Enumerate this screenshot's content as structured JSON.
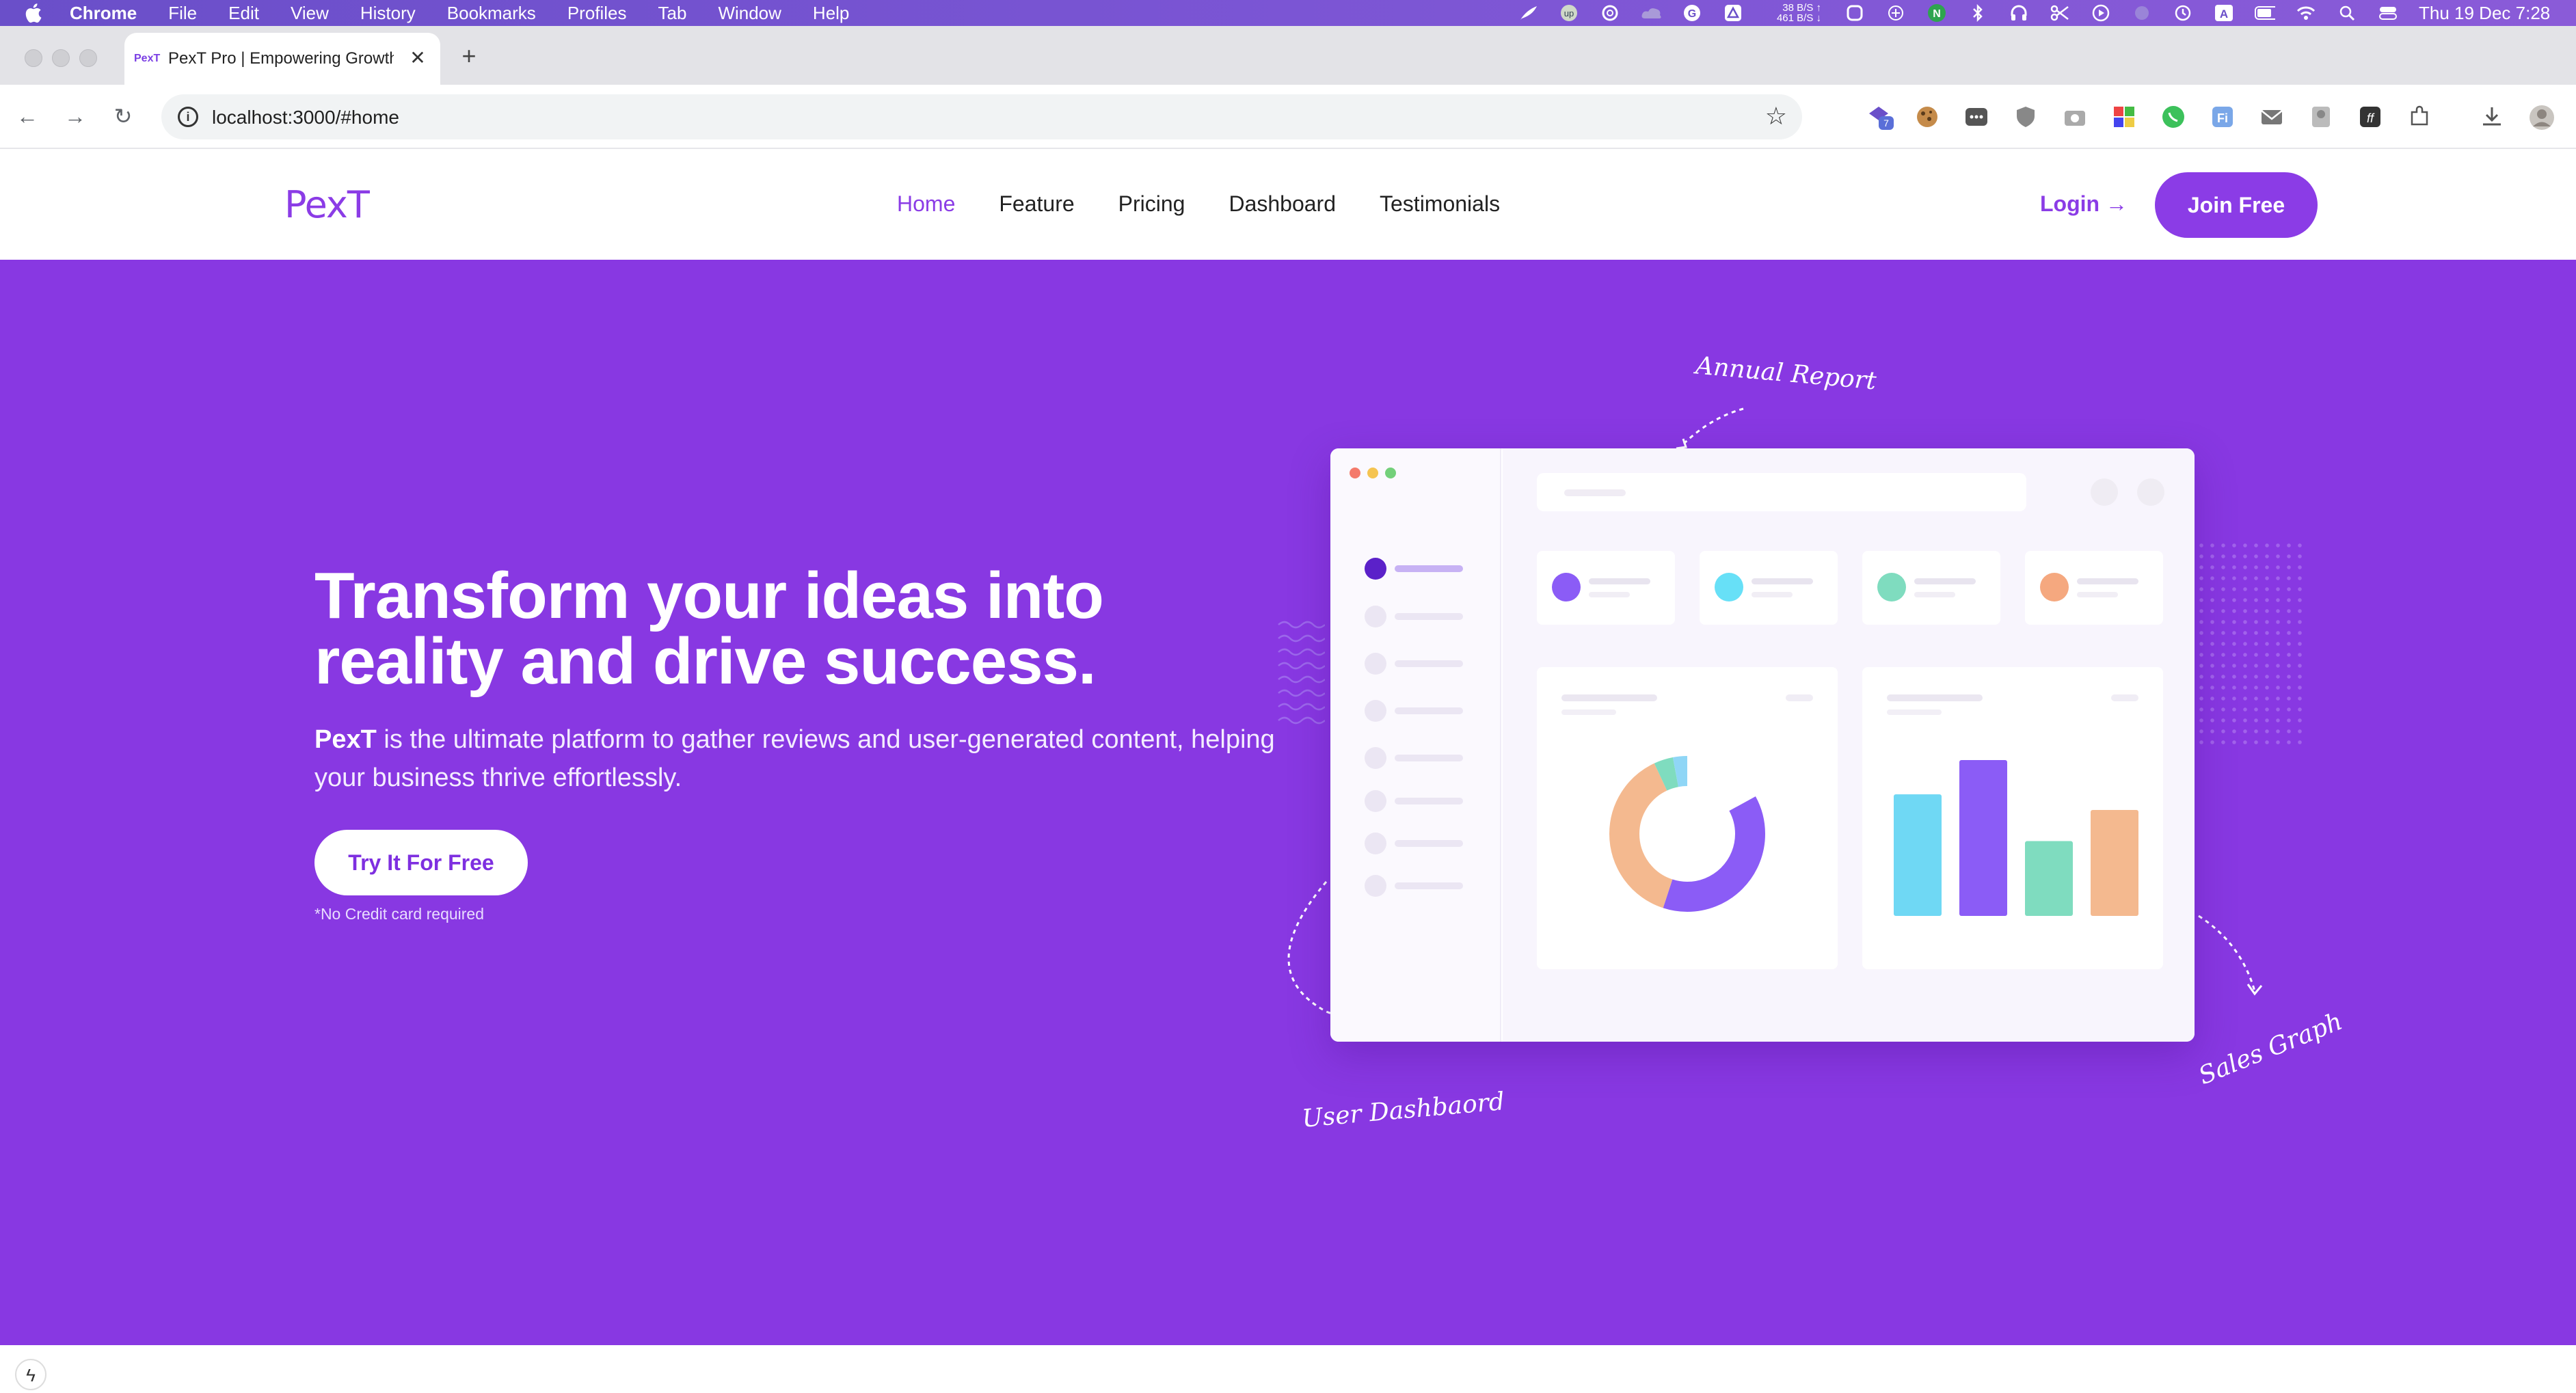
{
  "os": {
    "menus": [
      "Chrome",
      "File",
      "Edit",
      "View",
      "History",
      "Bookmarks",
      "Profiles",
      "Tab",
      "Window",
      "Help"
    ],
    "net_up": "38 B/S ↑",
    "net_down": "461 B/S ↓",
    "clock": "Thu 19 Dec  7:28"
  },
  "browser": {
    "tab_title": "PexT Pro | Empowering Growth",
    "favicon": "PexT",
    "url": "localhost:3000/#home",
    "ext_badge": "7"
  },
  "site": {
    "logo": "PexT",
    "nav": [
      "Home",
      "Feature",
      "Pricing",
      "Dashboard",
      "Testimonials"
    ],
    "active_nav": "Home",
    "login": "Login →",
    "join": "Join Free"
  },
  "hero": {
    "title_line1": "Transform your ideas into",
    "title_line2": "reality and drive success.",
    "brand": "PexT",
    "lead": " is the ultimate platform to gather reviews and user-generated content, helping your business thrive effortlessly.",
    "cta": "Try It For Free",
    "note": "*No Credit card required",
    "annotations": {
      "annual": "Annual Report",
      "user": "User Dashbaord",
      "sales": "Sales Graph"
    }
  },
  "colors": {
    "brand_purple": "#8838e2",
    "stat_dots": [
      "#8b5cf6",
      "#67e0f7",
      "#7fdcbf",
      "#f5a87f"
    ],
    "donut": [
      "#8b5cf6",
      "#f4b98f",
      "#7fdcbf",
      "#8fd6f6"
    ],
    "bars": [
      "#6fd8f4",
      "#8b5cf6",
      "#7fdcbf",
      "#f4b98f"
    ]
  },
  "mockup": {
    "donut_fractions": [
      0.38,
      0.38,
      0.04,
      0.2
    ],
    "bar_levels": [
      0.78,
      1.0,
      0.48,
      0.68
    ]
  }
}
